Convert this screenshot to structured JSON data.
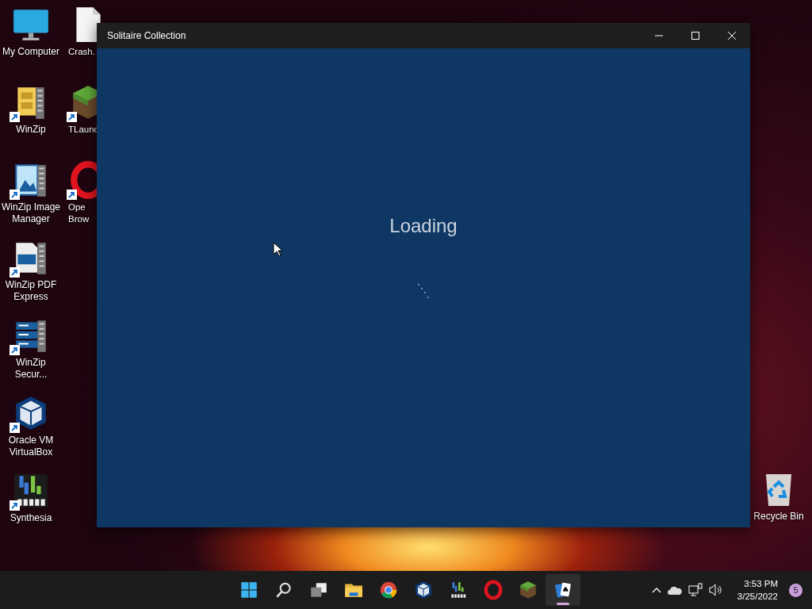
{
  "desktop_columns": [
    {
      "icons": [
        {
          "label": "My Computer",
          "kind": "monitor",
          "shortcut": false
        },
        {
          "label": "WinZip",
          "kind": "winzip",
          "shortcut": true
        },
        {
          "label": "WinZip Image Manager",
          "kind": "winzip-image",
          "shortcut": true
        },
        {
          "label": "WinZip PDF Express",
          "kind": "winzip-pdf",
          "shortcut": true
        },
        {
          "label": "WinZip Secur...",
          "kind": "winzip-server",
          "shortcut": true
        },
        {
          "label": "Oracle VM VirtualBox",
          "kind": "cube",
          "shortcut": true
        },
        {
          "label": "Synthesia",
          "kind": "keys",
          "shortcut": true
        }
      ]
    },
    {
      "icons": [
        {
          "label": "Crash.",
          "kind": "document",
          "shortcut": false
        },
        {
          "label": "TLaunc",
          "kind": "grass-block",
          "shortcut": true
        },
        {
          "label": "Ope Brow",
          "kind": "ring",
          "shortcut": true
        }
      ]
    }
  ],
  "recycle_bin": {
    "label": "Recycle Bin"
  },
  "window": {
    "title": "Solitaire Collection",
    "message": "Loading"
  },
  "taskbar": {
    "apps": [
      {
        "kind": "start",
        "selected": false
      },
      {
        "kind": "search",
        "selected": false
      },
      {
        "kind": "task-view",
        "selected": false
      },
      {
        "kind": "folder",
        "selected": false
      },
      {
        "kind": "browser",
        "selected": false
      },
      {
        "kind": "cube",
        "selected": false
      },
      {
        "kind": "keys",
        "selected": false
      },
      {
        "kind": "ring",
        "selected": false
      },
      {
        "kind": "grass-block",
        "selected": false
      },
      {
        "kind": "cards",
        "selected": true
      }
    ]
  },
  "tray": {
    "time": "3:53 PM",
    "date": "3/25/2022",
    "notifications": "5"
  }
}
